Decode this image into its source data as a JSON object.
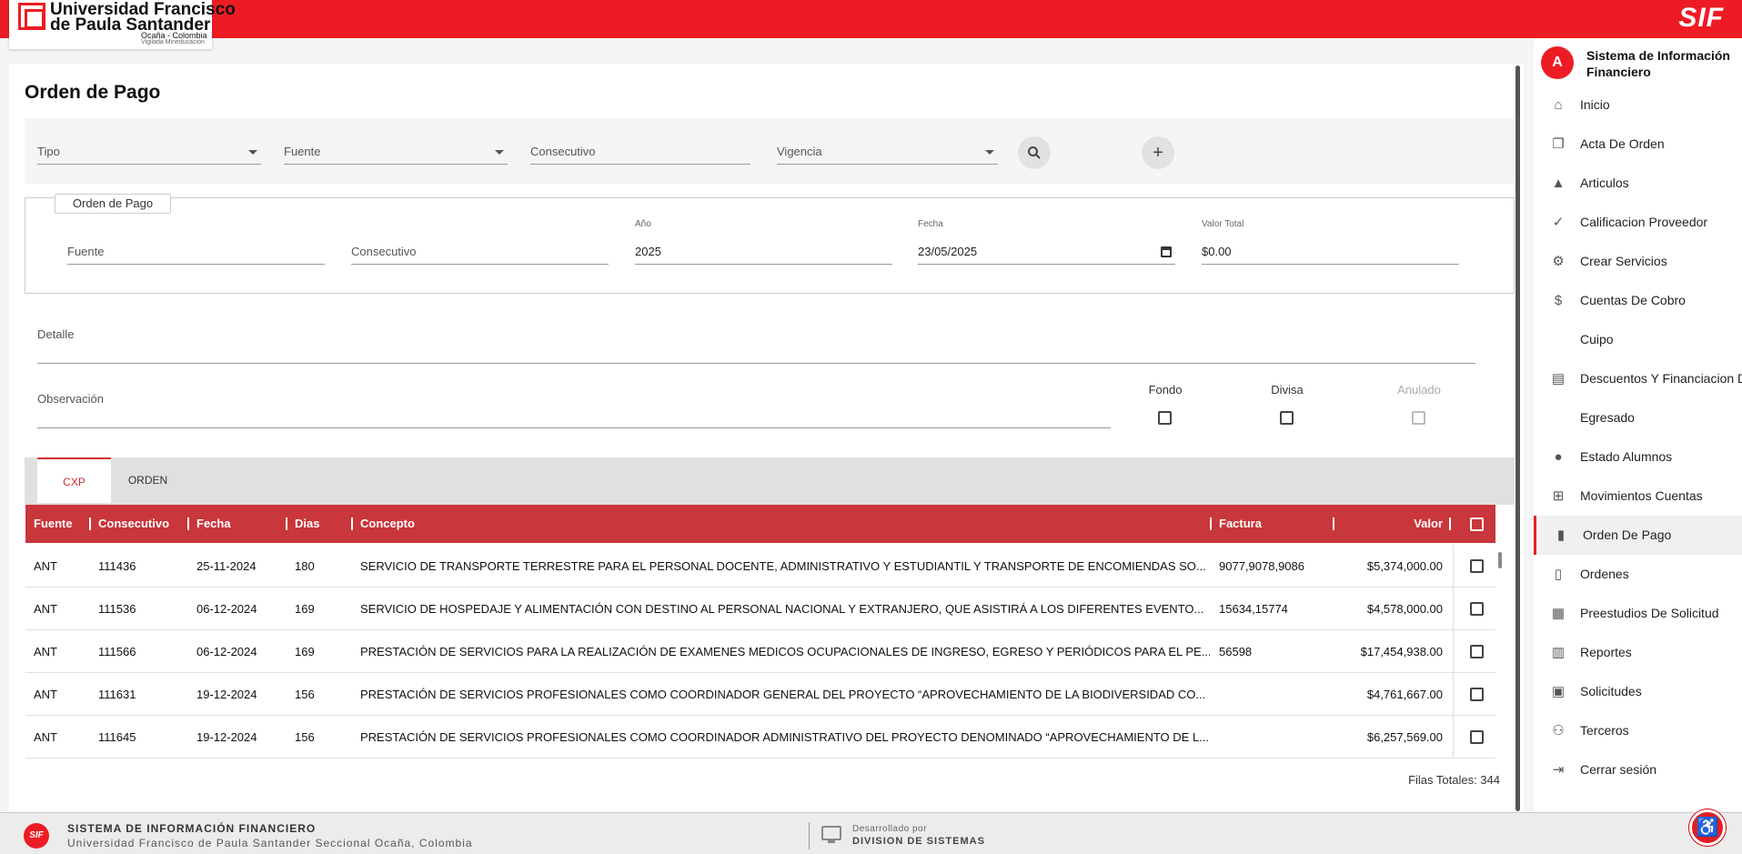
{
  "header": {
    "logo_line1": "Universidad Francisco",
    "logo_line2": "de Paula Santander",
    "logo_line3": "Ocaña - Colombia",
    "logo_line4": "Vigilada Mineducación",
    "app_short": "SIF"
  },
  "page": {
    "title": "Orden de Pago"
  },
  "filters": {
    "tipo": "Tipo",
    "fuente": "Fuente",
    "consecutivo": "Consecutivo",
    "vigencia": "Vigencia",
    "search_icon": "search-icon",
    "add_icon": "plus-icon"
  },
  "orden": {
    "legend": "Orden de Pago",
    "fuente_label": "Fuente",
    "consecutivo_label": "Consecutivo",
    "anio_label": "Año",
    "anio_value": "2025",
    "fecha_label": "Fecha",
    "fecha_value": "23/05/2025",
    "valor_label": "Valor Total",
    "valor_value": "$0.00"
  },
  "detalle_label": "Detalle",
  "observacion_label": "Observación",
  "checks": {
    "fondo": "Fondo",
    "divisa": "Divisa",
    "anulado": "Anulado"
  },
  "tabs": [
    {
      "label": "CXP"
    },
    {
      "label": "ORDEN"
    }
  ],
  "table": {
    "headers": {
      "fuente": "Fuente",
      "consecutivo": "Consecutivo",
      "fecha": "Fecha",
      "dias": "Dias",
      "concepto": "Concepto",
      "factura": "Factura",
      "valor": "Valor"
    },
    "rows": [
      {
        "fuente": "ANT",
        "consecutivo": "111436",
        "fecha": "25-11-2024",
        "dias": "180",
        "concepto": "SERVICIO DE TRANSPORTE TERRESTRE PARA EL PERSONAL DOCENTE, ADMINISTRATIVO Y ESTUDIANTIL Y TRANSPORTE DE ENCOMIENDAS SO...",
        "factura": "9077,9078,9086",
        "valor": "$5,374,000.00"
      },
      {
        "fuente": "ANT",
        "consecutivo": "111536",
        "fecha": "06-12-2024",
        "dias": "169",
        "concepto": "SERVICIO DE HOSPEDAJE Y ALIMENTACIÓN CON DESTINO AL PERSONAL NACIONAL Y EXTRANJERO, QUE ASISTIRÁ A LOS DIFERENTES EVENTO...",
        "factura": "15634,15774",
        "valor": "$4,578,000.00"
      },
      {
        "fuente": "ANT",
        "consecutivo": "111566",
        "fecha": "06-12-2024",
        "dias": "169",
        "concepto": "PRESTACIÓN DE SERVICIOS PARA LA REALIZACIÓN DE EXAMENES MEDICOS OCUPACIONALES DE INGRESO, EGRESO Y PERIÓDICOS PARA EL PE...",
        "factura": "56598",
        "valor": "$17,454,938.00"
      },
      {
        "fuente": "ANT",
        "consecutivo": "111631",
        "fecha": "19-12-2024",
        "dias": "156",
        "concepto": "PRESTACIÓN DE SERVICIOS PROFESIONALES COMO COORDINADOR GENERAL DEL PROYECTO “APROVECHAMIENTO DE LA BIODIVERSIDAD CO...",
        "factura": "",
        "valor": "$4,761,667.00"
      },
      {
        "fuente": "ANT",
        "consecutivo": "111645",
        "fecha": "19-12-2024",
        "dias": "156",
        "concepto": "PRESTACIÓN DE SERVICIOS PROFESIONALES COMO COORDINADOR ADMINISTRATIVO DEL PROYECTO DENOMINADO “APROVECHAMIENTO DE L...",
        "factura": "",
        "valor": "$6,257,569.00"
      }
    ],
    "filas_totales": "Filas Totales: 344"
  },
  "sidebar": {
    "avatar_letter": "A",
    "title": "Sistema de Información Financiero",
    "items": [
      {
        "label": "Inicio",
        "icon": "home-icon"
      },
      {
        "label": "Acta De Orden",
        "icon": "document-copy-icon"
      },
      {
        "label": "Articulos",
        "icon": "shapes-icon"
      },
      {
        "label": "Calificacion Proveedor",
        "icon": "rating-icon"
      },
      {
        "label": "Crear Servicios",
        "icon": "gears-icon"
      },
      {
        "label": "Cuentas De Cobro",
        "icon": "money-icon"
      },
      {
        "label": "Cuipo",
        "icon": ""
      },
      {
        "label": "Descuentos Y Financiacion De",
        "icon": "discount-icon"
      },
      {
        "label": "Egresado",
        "icon": ""
      },
      {
        "label": "Estado Alumnos",
        "icon": "person-icon"
      },
      {
        "label": "Movimientos Cuentas",
        "icon": "account-tree-icon"
      },
      {
        "label": "Orden De Pago",
        "icon": "payment-document-icon"
      },
      {
        "label": "Ordenes",
        "icon": "document-icon"
      },
      {
        "label": "Preestudios De Solicitud",
        "icon": "chart-document-icon"
      },
      {
        "label": "Reportes",
        "icon": "bar-chart-icon"
      },
      {
        "label": "Solicitudes",
        "icon": "request-document-icon"
      },
      {
        "label": "Terceros",
        "icon": "people-icon"
      },
      {
        "label": "Cerrar sesión",
        "icon": "logout-icon"
      }
    ]
  },
  "footer": {
    "title": "SISTEMA DE INFORMACIÓN FINANCIERO",
    "subtitle": "Universidad Francisco de Paula Santander Seccional Ocaña, Colombia",
    "dev_label": "Desarrollado por",
    "dev_name": "DIVISION DE SISTEMAS",
    "logo": "SIF"
  },
  "colors": {
    "brand_red": "#ed1c24",
    "header_row": "#c9363b"
  }
}
